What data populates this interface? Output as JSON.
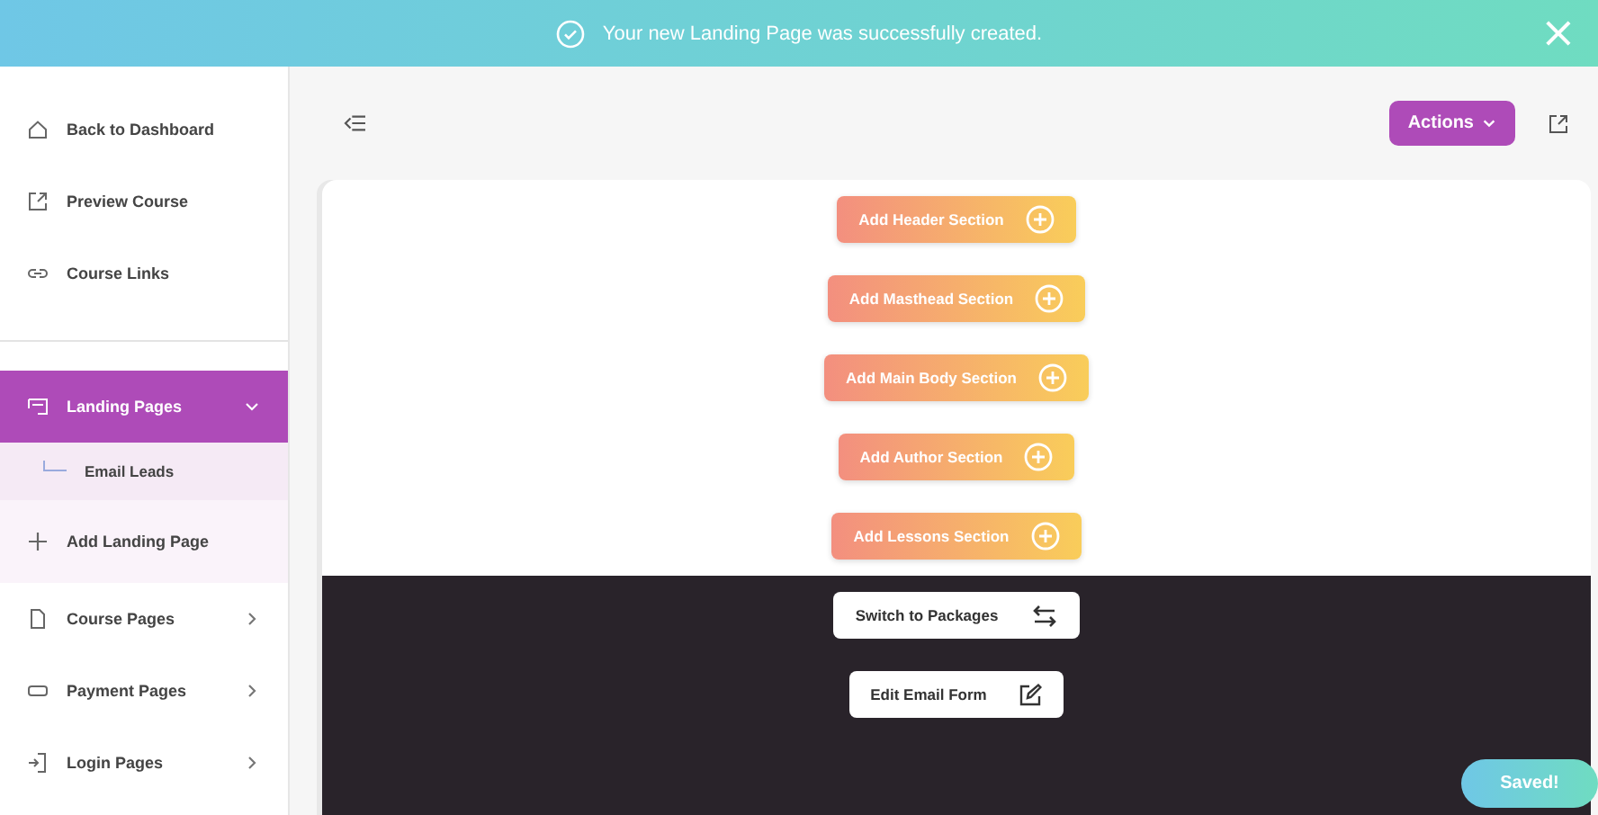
{
  "banner": {
    "message": "Your new Landing Page was successfully created.",
    "close": "×"
  },
  "sidebar": {
    "links": [
      {
        "label": "Back to Dashboard"
      },
      {
        "label": "Preview Course"
      },
      {
        "label": "Course Links"
      }
    ],
    "sections": [
      {
        "label": "Landing Pages",
        "selected": true,
        "expanded": true,
        "children": [
          {
            "label": "Email Leads"
          }
        ],
        "add_label": "Add Landing Page"
      },
      {
        "label": "Course Pages",
        "selected": false,
        "expanded": false
      },
      {
        "label": "Payment Pages",
        "selected": false,
        "expanded": false
      },
      {
        "label": "Login Pages",
        "selected": false,
        "expanded": false
      }
    ]
  },
  "toolbar": {
    "actions": "Actions"
  },
  "add_sections": [
    "Add Header Section",
    "Add Masthead Section",
    "Add Main Body Section",
    "Add Author Section",
    "Add Lessons Section"
  ],
  "form_buttons": [
    {
      "kind": "switch",
      "label": "Switch to Packages"
    },
    {
      "kind": "edit",
      "label": "Edit Email Form"
    }
  ],
  "saved": "Saved!"
}
